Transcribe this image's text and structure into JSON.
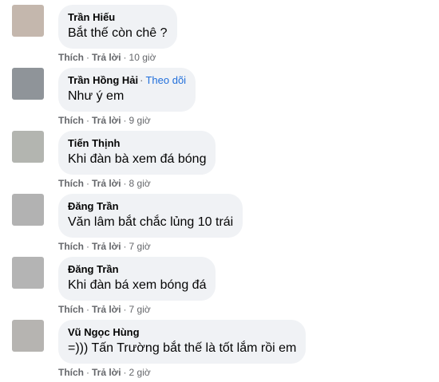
{
  "action_like": "Thích",
  "action_reply": "Trả lời",
  "dot": "·",
  "comments": [
    {
      "author": "Trần Hiếu",
      "follow": "",
      "text": "Bắt thế còn chê ?",
      "time": "10 giờ",
      "avatar_color": "#c4b7ad"
    },
    {
      "author": "Trần Hồng Hải",
      "follow": "Theo dõi",
      "text": "Như ý em",
      "time": "9 giờ",
      "avatar_color": "#8f9499"
    },
    {
      "author": "Tiến Thịnh",
      "follow": "",
      "text": "Khi đàn bà xem đá bóng",
      "time": "8 giờ",
      "avatar_color": "#b3b5b0"
    },
    {
      "author": "Đăng Trần",
      "follow": "",
      "text": "Văn lâm bắt chắc lủng 10 trái",
      "time": "7 giờ",
      "avatar_color": "#b2b2b2"
    },
    {
      "author": "Đăng Trần",
      "follow": "",
      "text": "Khi đàn bá xem bóng đá",
      "time": "7 giờ",
      "avatar_color": "#b4b4b4"
    },
    {
      "author": "Vũ Ngọc Hùng",
      "follow": "",
      "text": "=))) Tấn Trường bắt thế là tốt lắm rồi em",
      "time": "2 giờ",
      "avatar_color": "#b6b4b1"
    }
  ]
}
